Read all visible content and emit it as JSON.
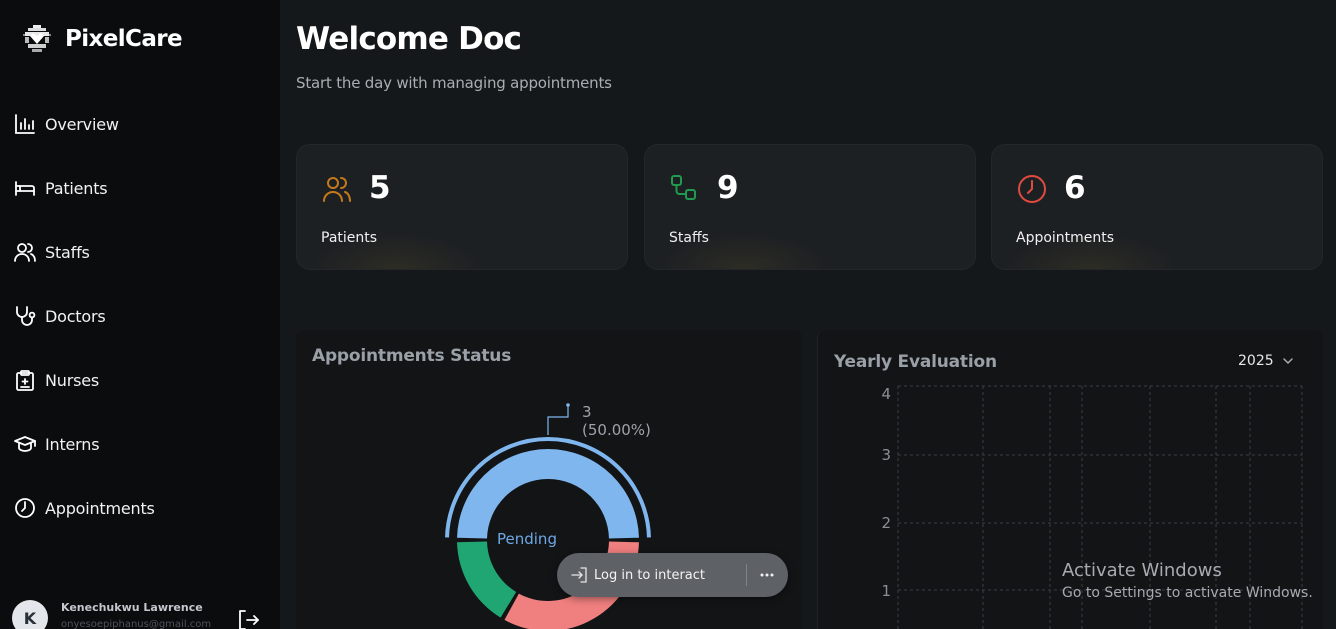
{
  "brand": {
    "name": "PixelCare"
  },
  "nav": {
    "items": [
      {
        "label": "Overview",
        "icon": "chart-bar-icon"
      },
      {
        "label": "Patients",
        "icon": "bed-icon"
      },
      {
        "label": "Staffs",
        "icon": "users-icon"
      },
      {
        "label": "Doctors",
        "icon": "stethoscope-icon"
      },
      {
        "label": "Nurses",
        "icon": "clipboard-medical-icon"
      },
      {
        "label": "Interns",
        "icon": "graduation-cap-icon"
      },
      {
        "label": "Appointments",
        "icon": "clock-icon"
      }
    ]
  },
  "user": {
    "initial": "K",
    "name": "Kenechukwu Lawrence",
    "email": "onyesoepiphanus@gmail.com"
  },
  "header": {
    "title": "Welcome Doc",
    "subtitle": "Start the day with managing appointments"
  },
  "stats": [
    {
      "label": "Patients",
      "value": "5",
      "icon": "users-icon",
      "color": "#c47a1c"
    },
    {
      "label": "Staffs",
      "value": "9",
      "icon": "workflow-icon",
      "color": "#1f9a4e"
    },
    {
      "label": "Appointments",
      "value": "6",
      "icon": "clock-icon",
      "color": "#e04a3f"
    }
  ],
  "appointments_status": {
    "title": "Appointments Status",
    "center_label": "Pending",
    "callout_value": "3",
    "callout_percent": "(50.00%)"
  },
  "yearly": {
    "title": "Yearly Evaluation",
    "year": "2025",
    "y_ticks": [
      "4",
      "3",
      "2",
      "1"
    ]
  },
  "chart_data": [
    {
      "type": "pie",
      "title": "Appointments Status",
      "categories": [
        "Pending",
        "",
        ""
      ],
      "values": [
        3,
        2,
        1
      ],
      "colors": [
        "#7fb6ee",
        "#f07f7f",
        "#20a672"
      ]
    },
    {
      "type": "line",
      "title": "Yearly Evaluation",
      "ylim": [
        0,
        4
      ],
      "yticks": [
        1,
        2,
        3,
        4
      ],
      "grid": true,
      "series": []
    }
  ],
  "watermark": {
    "title": "Activate Windows",
    "subtitle": "Go to Settings to activate Windows."
  },
  "overlay": {
    "login_label": "Log in to interact"
  },
  "colors": {
    "background": "#15181b",
    "sidebar": "#0b0c0d",
    "card": "#1d2023",
    "pending": "#7fb6ee"
  }
}
